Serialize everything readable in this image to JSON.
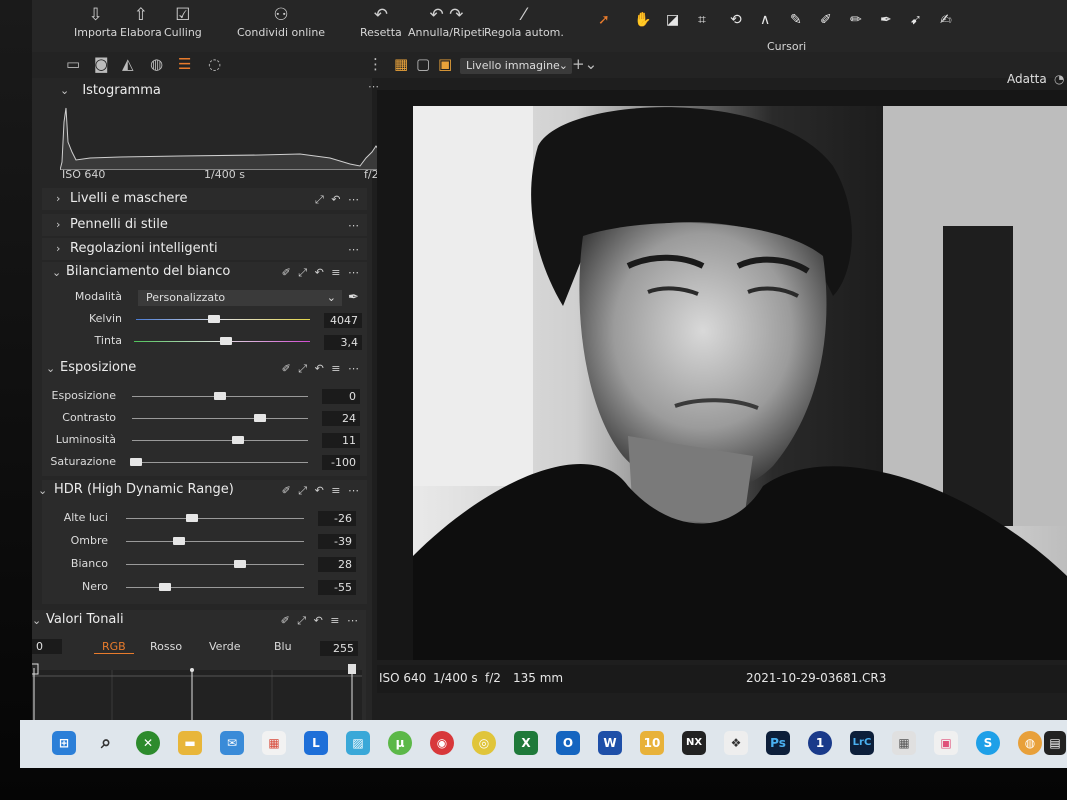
{
  "toolbar": {
    "import": "Importa",
    "process": "Elabora",
    "culling": "Culling",
    "share": "Condividi online",
    "reset": "Resetta",
    "undo_redo": "Annulla/Ripeti",
    "auto_adjust": "Regola autom.",
    "cursors": "Cursori"
  },
  "viewer_bar": {
    "layer": "Livello immagine",
    "fit": "Adatta"
  },
  "histogram": {
    "title": "Istogramma",
    "iso": "ISO 640",
    "shutter": "1/400 s",
    "aperture": "f/2"
  },
  "sections": {
    "layers": "Livelli e maschere",
    "styles": "Pennelli di stile",
    "smart": "Regolazioni intelligenti",
    "wb": "Bilanciamento del bianco",
    "exposure": "Esposizione",
    "hdr": "HDR (High Dynamic Range)",
    "levels": "Valori Tonali"
  },
  "white_balance": {
    "mode_label": "Modalità",
    "mode_value": "Personalizzato",
    "kelvin_label": "Kelvin",
    "kelvin": "4047",
    "kelvin_pos": 0.45,
    "tint_label": "Tinta",
    "tint": "3,4",
    "tint_pos": 0.52
  },
  "exposure": {
    "rows": [
      {
        "label": "Esposizione",
        "value": "0",
        "pos": 0.5
      },
      {
        "label": "Contrasto",
        "value": "24",
        "pos": 0.73
      },
      {
        "label": "Luminosità",
        "value": "11",
        "pos": 0.6
      },
      {
        "label": "Saturazione",
        "value": "-100",
        "pos": 0.02
      }
    ]
  },
  "hdr": {
    "rows": [
      {
        "label": "Alte luci",
        "value": "-26",
        "pos": 0.37
      },
      {
        "label": "Ombre",
        "value": "-39",
        "pos": 0.3
      },
      {
        "label": "Bianco",
        "value": "28",
        "pos": 0.64
      },
      {
        "label": "Nero",
        "value": "-55",
        "pos": 0.22
      }
    ]
  },
  "levels": {
    "min": "0",
    "max": "255",
    "tabs": [
      "RGB",
      "Rosso",
      "Verde",
      "Blu"
    ]
  },
  "image_meta": {
    "iso": "ISO 640",
    "shutter": "1/400 s",
    "aperture": "f/2",
    "focal": "135 mm",
    "filename": "2021-10-29-03681.CR3"
  },
  "taskbar": {
    "icons": [
      "start-icon",
      "search-icon",
      "xbox-icon",
      "file-explorer-icon",
      "mail-icon",
      "store-icon",
      "l-app-icon",
      "photos-icon",
      "utorrent-icon",
      "norton-icon",
      "chrome-icon",
      "excel-icon",
      "outlook-icon",
      "word-icon",
      "app-10-icon",
      "nx-icon",
      "darktable-icon",
      "photoshop-icon",
      "onepassword-icon",
      "lightroom-classic-icon",
      "app-grid-icon",
      "calendar-app-icon",
      "skype-icon",
      "globe-app-icon",
      "clapper-icon"
    ],
    "labels": {
      "l": "L",
      "ten": "10",
      "nx": "NX",
      "ps": "Ps",
      "one": "1",
      "lrc": "LrC",
      "skype": "S"
    }
  },
  "colors": {
    "accent": "#e87b2c",
    "panel": "#262626"
  }
}
